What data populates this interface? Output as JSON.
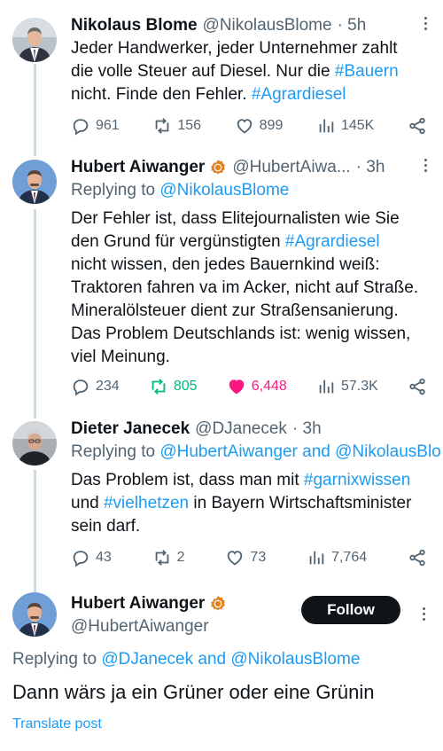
{
  "tweets": [
    {
      "name": "Nikolaus Blome",
      "handle": "@NikolausBlome",
      "time": "· 5h",
      "text_lines": [
        [
          {
            "t": "Jeder Handwerker, jeder Unternehmer zahlt"
          }
        ],
        [
          {
            "t": "die volle Steuer auf Diesel. Nur die "
          },
          {
            "t": "#Bauern",
            "link": true
          }
        ],
        [
          {
            "t": "nicht. Finde den Fehler.  "
          },
          {
            "t": "#Agrardiesel",
            "link": true
          }
        ]
      ],
      "stats": {
        "replies": "961",
        "reposts": "156",
        "likes": "899",
        "views": "145K"
      }
    },
    {
      "name": "Hubert Aiwanger",
      "handle": "@HubertAiwa...",
      "time": "· 3h",
      "replying_prefix": "Replying to ",
      "replying_to": "@NikolausBlome",
      "text_lines": [
        [
          {
            "t": "Der Fehler ist, dass Elitejournalisten wie Sie"
          }
        ],
        [
          {
            "t": "den Grund für vergünstigten "
          },
          {
            "t": "#Agrardiesel",
            "link": true
          }
        ],
        [
          {
            "t": "nicht wissen, den jedes Bauernkind weiß:"
          }
        ],
        [
          {
            "t": "Traktoren fahren va im Acker, nicht auf Straße."
          }
        ],
        [
          {
            "t": "Mineralölsteuer dient zur Straßensanierung."
          }
        ],
        [
          {
            "t": "Das Problem Deutschlands ist: wenig wissen,"
          }
        ],
        [
          {
            "t": "viel Meinung."
          }
        ]
      ],
      "stats": {
        "replies": "234",
        "reposts": "805",
        "likes": "6,448",
        "views": "57.3K"
      }
    },
    {
      "name": "Dieter Janecek",
      "handle": "@DJanecek",
      "time": "· 3h",
      "replying_prefix": "Replying to ",
      "replying_to": "@HubertAiwanger and @NikolausBlo",
      "text_lines": [
        [
          {
            "t": "Das Problem ist, dass man mit "
          },
          {
            "t": "#garnixwissen",
            "link": true
          }
        ],
        [
          {
            "t": "und "
          },
          {
            "t": "#vielhetzen",
            "link": true
          },
          {
            "t": " in Bayern Wirtschaftsminister"
          }
        ],
        [
          {
            "t": "sein darf."
          }
        ]
      ],
      "stats": {
        "replies": "43",
        "reposts": "2",
        "likes": "73",
        "views": "7,764"
      }
    }
  ],
  "main_tweet": {
    "name": "Hubert Aiwanger",
    "handle": "@HubertAiwanger",
    "follow_label": "Follow",
    "replying_prefix": "Replying to ",
    "replying_to": "@DJanecek and @NikolausBlome",
    "text": "Dann wärs ja ein Grüner oder eine Grünin",
    "translate_label": "Translate post"
  },
  "colors": {
    "link": "#1d9bf0",
    "secondary_text": "#536471",
    "repost_active": "#00ba7c",
    "like_active": "#f91880",
    "verified_badge": "#e2811f"
  },
  "icons": [
    "reply-icon",
    "repost-icon",
    "like-icon",
    "views-icon",
    "share-icon",
    "verified-badge-icon",
    "more-icon"
  ]
}
